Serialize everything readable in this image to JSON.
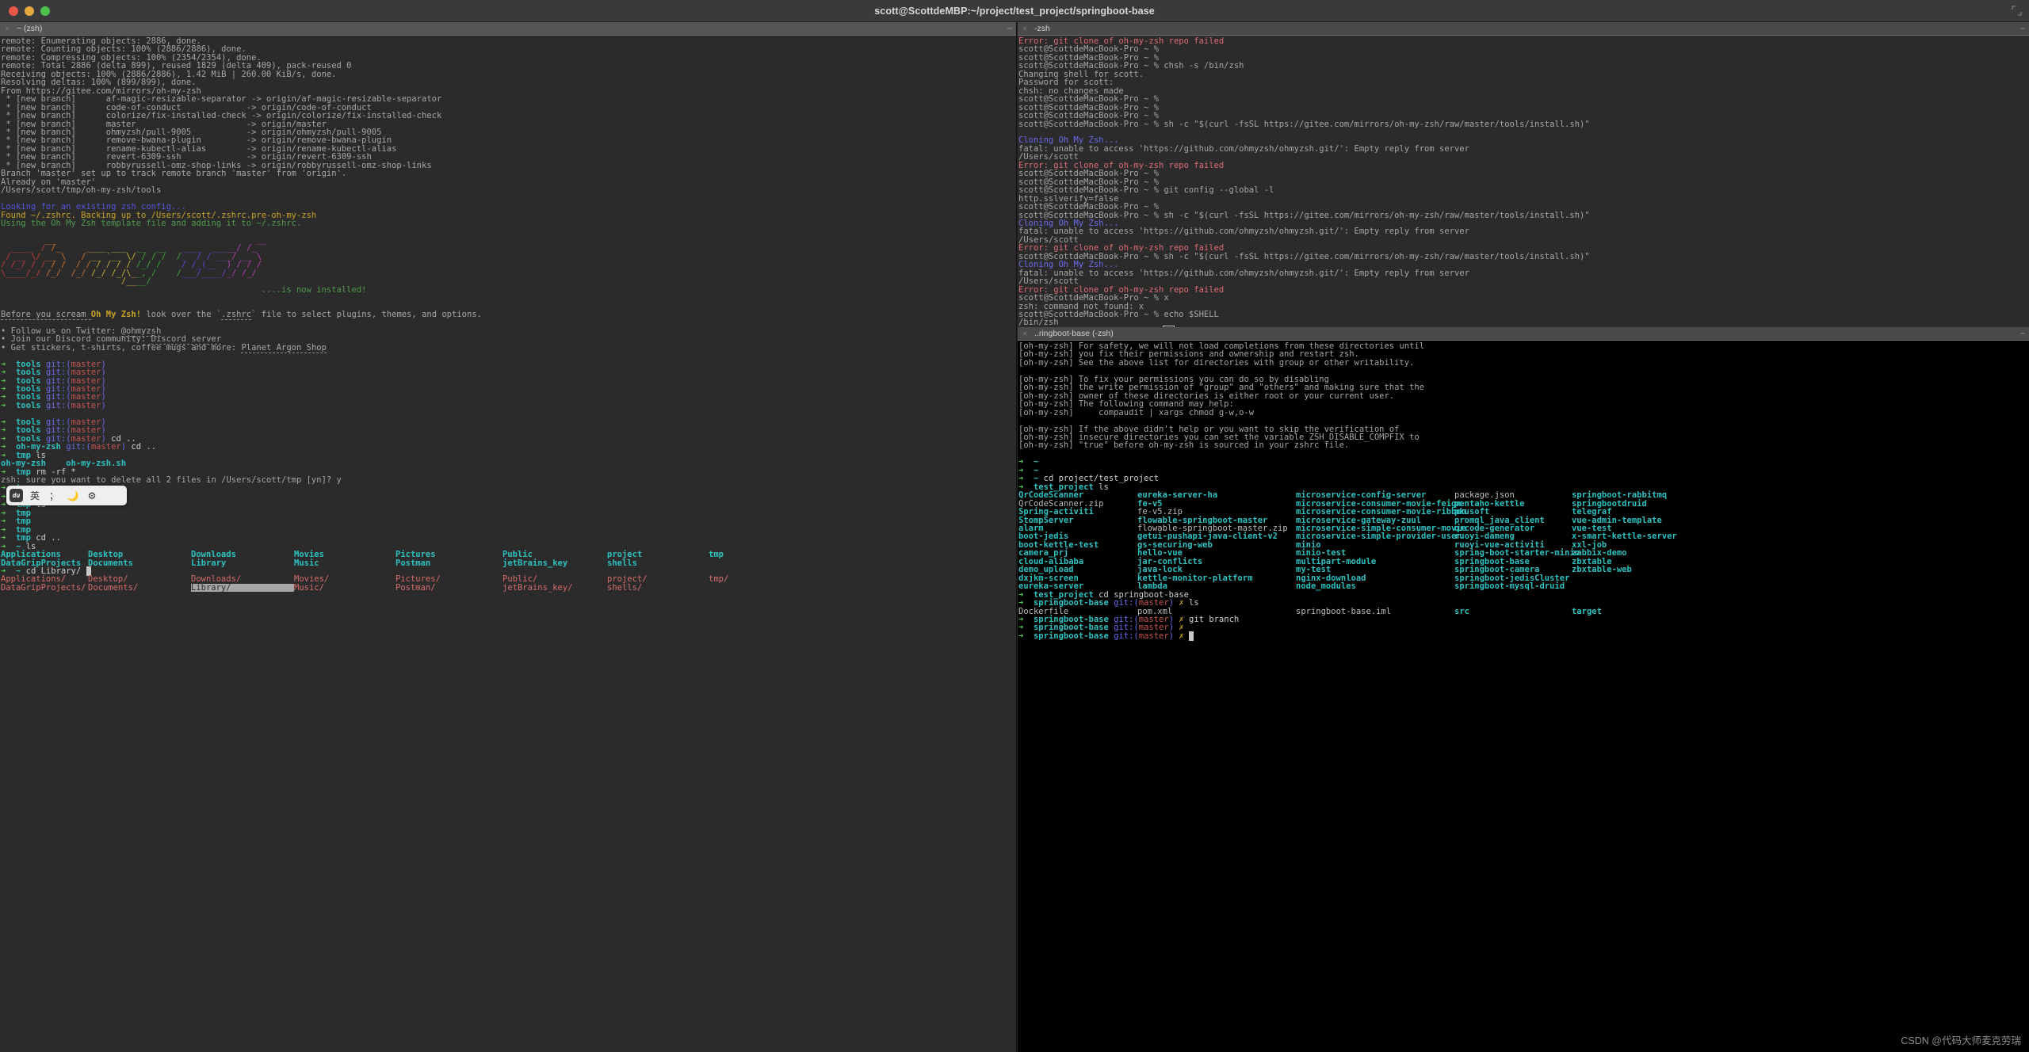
{
  "window": {
    "title": "scott@ScottdeMBP:~/project/test_project/springboot-base",
    "traffic_lights": [
      "close-red",
      "minimize-yellow",
      "zoom-green"
    ],
    "expand_icon": "expand-icon"
  },
  "watermark": "CSDN @代码大师麦克劳瑞",
  "ime_toolbar": {
    "logo": "du",
    "items": [
      "英",
      ";",
      "moon-icon",
      "gear-icon"
    ]
  },
  "panes": {
    "left": {
      "tab_title": "~ (zsh)",
      "close_icon": "close-icon",
      "menu_icon": "menu-icon",
      "lines": [
        "remote: Enumerating objects: 2886, done.",
        "remote: Counting objects: 100% (2886/2886), done.",
        "remote: Compressing objects: 100% (2354/2354), done.",
        "remote: Total 2886 (delta 899), reused 1829 (delta 409), pack-reused 0",
        "Receiving objects: 100% (2886/2886), 1.42 MiB | 260.00 KiB/s, done.",
        "Resolving deltas: 100% (899/899), done.",
        "From https://gitee.com/mirrors/oh-my-zsh",
        " * [new branch]      af-magic-resizable-separator -> origin/af-magic-resizable-separator",
        " * [new branch]      code-of-conduct             -> origin/code-of-conduct",
        " * [new branch]      colorize/fix-installed-check -> origin/colorize/fix-installed-check",
        " * [new branch]      master                      -> origin/master",
        " * [new branch]      ohmyzsh/pull-9005           -> origin/ohmyzsh/pull-9005",
        " * [new branch]      remove-bwana-plugin         -> origin/remove-bwana-plugin",
        " * [new branch]      rename-kubectl-alias        -> origin/rename-kubectl-alias",
        " * [new branch]      revert-6309-ssh             -> origin/revert-6309-ssh",
        " * [new branch]      robbyrussell-omz-shop-links -> origin/robbyrussell-omz-shop-links",
        "Branch 'master' set up to track remote branch 'master' from 'origin'.",
        "Already on 'master'",
        "/Users/scott/tmp/oh-my-zsh/tools"
      ],
      "zsh_config_lines": [
        "Looking for an existing zsh config...",
        "Found ~/.zshrc. Backing up to /Users/scott/.zshrc.pre-oh-my-zsh",
        "Using the Oh My Zsh template file and adding it to ~/.zshrc."
      ],
      "ascii_art": [
        "         __                                        __   ",
        "  ____  / /_     ____ ___  __  __   ____  _____/ /_  ",
        " / __ \\/ __ \\   / __ `__ \\/ / / /  /_  / / ___/ __ \\ ",
        "/ /_/ / / / /  / / / / / / /_/ /    / /_(__  ) / / / ",
        "\\____/_/ /_/  /_/ /_/ /_/\\__, /    /___/____/_/ /_/  ",
        "                        /____/                       "
      ],
      "installed_note": "....is now installed!",
      "post_install": [
        "Before you scream Oh My Zsh! look over the `.zshrc` file to select plugins, themes, and options.",
        "• Follow us on Twitter: @ohmyzsh",
        "• Join our Discord community: Discord server",
        "• Get stickers, t-shirts, coffee mugs and more: Planet Argon Shop"
      ],
      "prompt_block_1": [
        {
          "dir": "tools",
          "git": "master",
          "cmd": ""
        },
        {
          "dir": "tools",
          "git": "master",
          "cmd": ""
        },
        {
          "dir": "tools",
          "git": "master",
          "cmd": ""
        },
        {
          "dir": "tools",
          "git": "master",
          "cmd": ""
        },
        {
          "dir": "tools",
          "git": "master",
          "cmd": ""
        },
        {
          "dir": "tools",
          "git": "master",
          "cmd": ""
        }
      ],
      "prompt_block_2": [
        {
          "dir": "tools",
          "git": "master",
          "cmd": ""
        },
        {
          "dir": "tools",
          "git": "master",
          "cmd": ""
        },
        {
          "dir": "tools",
          "git": "master",
          "cmd": "cd .."
        },
        {
          "dir": "oh-my-zsh",
          "git": "master",
          "cmd": "cd .."
        },
        {
          "dir": "tmp",
          "git": "",
          "cmd": "ls"
        }
      ],
      "tmp_ls_output": "oh-my-zsh    oh-my-zsh.sh",
      "rm_line": {
        "dir": "tmp",
        "cmd": "rm -rf *"
      },
      "rm_confirm": "zsh: sure you want to delete all 2 files in /Users/scott/tmp [yn]? y",
      "prompt_block_3": [
        {
          "dir": "tmp",
          "cmd": ""
        },
        {
          "dir": "tmp",
          "cmd": ""
        },
        {
          "dir": "tmp",
          "cmd": "ls"
        },
        {
          "dir": "tmp",
          "cmd": ""
        },
        {
          "dir": "tmp",
          "cmd": ""
        },
        {
          "dir": "tmp",
          "cmd": ""
        },
        {
          "dir": "tmp",
          "cmd": "cd .."
        },
        {
          "dir": "~",
          "cmd": "ls"
        }
      ],
      "home_ls": [
        [
          "Applications",
          "Desktop",
          "Downloads",
          "Movies",
          "Pictures",
          "Public",
          "project",
          "tmp"
        ],
        [
          "DataGripProjects",
          "Documents",
          "Library",
          "Music",
          "Postman",
          "jetBrains_key",
          "shells",
          ""
        ]
      ],
      "cd_line": {
        "dir": "~",
        "cmd": "cd Library/"
      },
      "completion_menu": {
        "rows": [
          [
            "Applications/",
            "Desktop/",
            "Downloads/",
            "Movies/",
            "Pictures/",
            "Public/",
            "project/",
            "tmp/"
          ],
          [
            "DataGripProjects/",
            "Documents/",
            "Library/",
            "Music/",
            "Postman/",
            "jetBrains_key/",
            "shells/",
            ""
          ]
        ],
        "selected": "Library/"
      }
    },
    "right_top": {
      "tab_title": "-zsh",
      "close_icon": "close-icon",
      "menu_icon": "menu-icon",
      "prompt": "scott@ScottdeMacBook-Pro ~ %",
      "lines": [
        {
          "t": "err",
          "s": "Error: git clone of oh-my-zsh repo failed"
        },
        {
          "t": "p",
          "s": ""
        },
        {
          "t": "p",
          "s": ""
        },
        {
          "t": "p",
          "s": "chsh -s /bin/zsh"
        },
        {
          "t": "out",
          "s": "Changing shell for scott."
        },
        {
          "t": "out",
          "s": "Password for scott:"
        },
        {
          "t": "out",
          "s": "chsh: no changes made"
        },
        {
          "t": "p",
          "s": ""
        },
        {
          "t": "p",
          "s": ""
        },
        {
          "t": "p",
          "s": ""
        },
        {
          "t": "p",
          "s": "sh -c \"$(curl -fsSL https://gitee.com/mirrors/oh-my-zsh/raw/master/tools/install.sh)\""
        },
        {
          "t": "blank",
          "s": ""
        },
        {
          "t": "blue",
          "s": "Cloning Oh My Zsh..."
        },
        {
          "t": "out",
          "s": "fatal: unable to access 'https://github.com/ohmyzsh/ohmyzsh.git/': Empty reply from server"
        },
        {
          "t": "out",
          "s": "/Users/scott"
        },
        {
          "t": "err",
          "s": "Error: git clone of oh-my-zsh repo failed"
        },
        {
          "t": "p",
          "s": ""
        },
        {
          "t": "p",
          "s": ""
        },
        {
          "t": "p",
          "s": "git config --global -l"
        },
        {
          "t": "out",
          "s": "http.sslverify=false"
        },
        {
          "t": "p",
          "s": ""
        },
        {
          "t": "p",
          "s": "sh -c \"$(curl -fsSL https://gitee.com/mirrors/oh-my-zsh/raw/master/tools/install.sh)\""
        },
        {
          "t": "blue",
          "s": "Cloning Oh My Zsh..."
        },
        {
          "t": "out",
          "s": "fatal: unable to access 'https://github.com/ohmyzsh/ohmyzsh.git/': Empty reply from server"
        },
        {
          "t": "out",
          "s": "/Users/scott"
        },
        {
          "t": "err",
          "s": "Error: git clone of oh-my-zsh repo failed"
        },
        {
          "t": "p",
          "s": "sh -c \"$(curl -fsSL https://gitee.com/mirrors/oh-my-zsh/raw/master/tools/install.sh)\""
        },
        {
          "t": "blue",
          "s": "Cloning Oh My Zsh..."
        },
        {
          "t": "out",
          "s": "fatal: unable to access 'https://github.com/ohmyzsh/ohmyzsh.git/': Empty reply from server"
        },
        {
          "t": "out",
          "s": "/Users/scott"
        },
        {
          "t": "err",
          "s": "Error: git clone of oh-my-zsh repo failed"
        },
        {
          "t": "p",
          "s": "x"
        },
        {
          "t": "out",
          "s": "zsh: command not found: x"
        },
        {
          "t": "p",
          "s": "echo $SHELL"
        },
        {
          "t": "out",
          "s": "/bin/zsh"
        },
        {
          "t": "pcur",
          "s": ""
        }
      ]
    },
    "right_bottom": {
      "tab_title": "..ringboot-base (-zsh)",
      "close_icon": "close-icon",
      "menu_icon": "menu-icon",
      "omz_warnings": [
        "[oh-my-zsh] For safety, we will not load completions from these directories until",
        "[oh-my-zsh] you fix their permissions and ownership and restart zsh.",
        "[oh-my-zsh] See the above list for directories with group or other writability.",
        "",
        "[oh-my-zsh] To fix your permissions you can do so by disabling",
        "[oh-my-zsh] the write permission of \"group\" and \"others\" and making sure that the",
        "[oh-my-zsh] owner of these directories is either root or your current user.",
        "[oh-my-zsh] The following command may help:",
        "[oh-my-zsh]     compaudit | xargs chmod g-w,o-w",
        "",
        "[oh-my-zsh] If the above didn't help or you want to skip the verification of",
        "[oh-my-zsh] insecure directories you can set the variable ZSH_DISABLE_COMPFIX to",
        "[oh-my-zsh] \"true\" before oh-my-zsh is sourced in your zshrc file."
      ],
      "prompts_before_ls": [
        {
          "dir": "~",
          "cmd": ""
        },
        {
          "dir": "~",
          "cmd": ""
        },
        {
          "dir": "~",
          "cmd": "cd project/test_project"
        },
        {
          "dir": "test_project",
          "cmd": "ls"
        }
      ],
      "ls_columns": [
        [
          "QrCodeScanner",
          "QrCodeScanner.zip",
          "Spring-activiti",
          "StompServer",
          "alarm",
          "boot-jedis",
          "boot-kettle-test",
          "camera_prj",
          "cloud-alibaba",
          "demo_upload",
          "dxjkm-screen",
          "eureka-server"
        ],
        [
          "eureka-server-ha",
          "fe-v5",
          "fe-v5.zip",
          "flowable-springboot-master",
          "flowable-springboot-master.zip",
          "getui-pushapi-java-client-v2",
          "gs-securing-web",
          "hello-vue",
          "jar-conflicts",
          "java-lock",
          "kettle-monitor-platform",
          "lambda"
        ],
        [
          "microservice-config-server",
          "microservice-consumer-movie-feign",
          "microservice-consumer-movie-ribbon",
          "microservice-gateway-zuul",
          "microservice-simple-consumer-movie",
          "microservice-simple-provider-user",
          "minio",
          "minio-test",
          "multipart-module",
          "my-test",
          "nginx-download",
          "node_modules"
        ],
        [
          "package.json",
          "pentaho-kettle",
          "pkusoft",
          "promql_java_client",
          "qrcode-generator",
          "ruoyi-dameng",
          "ruoyi-vue-activiti",
          "spring-boot-starter-minio",
          "springboot-base",
          "springboot-camera",
          "springboot-jedisCluster",
          "springboot-mysql-druid"
        ],
        [
          "springboot-rabbitmq",
          "springbootdruid",
          "telegraf",
          "vue-admin-template",
          "vue-test",
          "x-smart-kettle-server",
          "xxl-job",
          "zabbix-demo",
          "zbxtable",
          "zbxtable-web",
          "",
          ""
        ]
      ],
      "ls_plain_files": [
        "QrCodeScanner.zip",
        "fe-v5.zip",
        "flowable-springboot-master.zip",
        "package.json"
      ],
      "tail_prompts": [
        {
          "dir": "test_project",
          "git": "",
          "cmd": "cd springboot-base"
        },
        {
          "dir": "springboot-base",
          "git": "master",
          "dirty": true,
          "cmd": "ls"
        }
      ],
      "springboot_ls": [
        "Dockerfile",
        "pom.xml",
        "springboot-base.iml",
        "src",
        "target"
      ],
      "final_prompts": [
        {
          "dir": "springboot-base",
          "git": "master",
          "dirty": true,
          "cmd": "git branch"
        },
        {
          "dir": "springboot-base",
          "git": "master",
          "dirty": true,
          "cmd": ""
        },
        {
          "dir": "springboot-base",
          "git": "master",
          "dirty": true,
          "cmd": "",
          "cursor": true
        }
      ]
    }
  }
}
